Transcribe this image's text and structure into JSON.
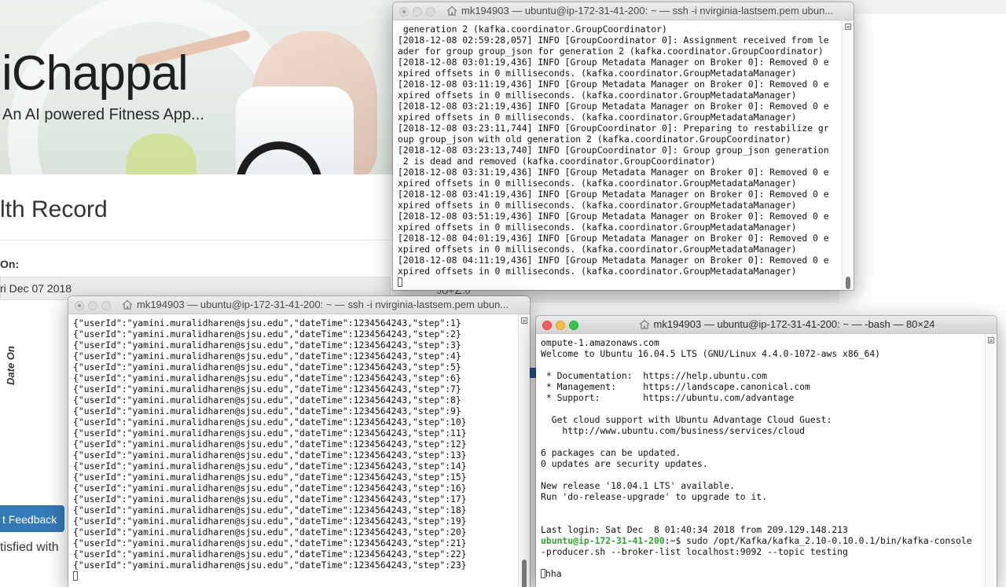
{
  "webpage": {
    "brand": "iChappal",
    "tagline": "An AI powered Fitness App...",
    "record_title": "lth Record",
    "on_label": "On:",
    "date_value": "ri Dec 07 2018",
    "date_on_label": "Date On",
    "feedback_button": "t Feedback",
    "satisfied_text": "tisfied with",
    "behind_text": "JU+∠.0"
  },
  "windows": {
    "kafka_server": {
      "title": "mk194903 — ubuntu@ip-172-31-41-200: ~ — ssh -i nvirginia-lastsem.pem ubun...",
      "lines": [
        " generation 2 (kafka.coordinator.GroupCoordinator)",
        "[2018-12-08 02:59:28,057] INFO [GroupCoordinator 0]: Assignment received from le",
        "ader for group group_json for generation 2 (kafka.coordinator.GroupCoordinator)",
        "[2018-12-08 03:01:19,436] INFO [Group Metadata Manager on Broker 0]: Removed 0 e",
        "xpired offsets in 0 milliseconds. (kafka.coordinator.GroupMetadataManager)",
        "[2018-12-08 03:11:19,436] INFO [Group Metadata Manager on Broker 0]: Removed 0 e",
        "xpired offsets in 0 milliseconds. (kafka.coordinator.GroupMetadataManager)",
        "[2018-12-08 03:21:19,436] INFO [Group Metadata Manager on Broker 0]: Removed 0 e",
        "xpired offsets in 0 milliseconds. (kafka.coordinator.GroupMetadataManager)",
        "[2018-12-08 03:23:11,744] INFO [GroupCoordinator 0]: Preparing to restabilize gr",
        "oup group_json with old generation 2 (kafka.coordinator.GroupCoordinator)",
        "[2018-12-08 03:23:13,740] INFO [GroupCoordinator 0]: Group group_json generation",
        " 2 is dead and removed (kafka.coordinator.GroupCoordinator)",
        "[2018-12-08 03:31:19,436] INFO [Group Metadata Manager on Broker 0]: Removed 0 e",
        "xpired offsets in 0 milliseconds. (kafka.coordinator.GroupMetadataManager)",
        "[2018-12-08 03:41:19,436] INFO [Group Metadata Manager on Broker 0]: Removed 0 e",
        "xpired offsets in 0 milliseconds. (kafka.coordinator.GroupMetadataManager)",
        "[2018-12-08 03:51:19,436] INFO [Group Metadata Manager on Broker 0]: Removed 0 e",
        "xpired offsets in 0 milliseconds. (kafka.coordinator.GroupMetadataManager)",
        "[2018-12-08 04:01:19,436] INFO [Group Metadata Manager on Broker 0]: Removed 0 e",
        "xpired offsets in 0 milliseconds. (kafka.coordinator.GroupMetadataManager)",
        "[2018-12-08 04:11:19,436] INFO [Group Metadata Manager on Broker 0]: Removed 0 e",
        "xpired offsets in 0 milliseconds. (kafka.coordinator.GroupMetadataManager)"
      ]
    },
    "consumer": {
      "title": "mk194903 — ubuntu@ip-172-31-41-200: ~ — ssh -i nvirginia-lastsem.pem ubun...",
      "lines": [
        "{\"userId\":\"yamini.muralidharen@sjsu.edu\",\"dateTime\":1234564243,\"step\":1}",
        "{\"userId\":\"yamini.muralidharen@sjsu.edu\",\"dateTime\":1234564243,\"step\":2}",
        "{\"userId\":\"yamini.muralidharen@sjsu.edu\",\"dateTime\":1234564243,\"step\":3}",
        "{\"userId\":\"yamini.muralidharen@sjsu.edu\",\"dateTime\":1234564243,\"step\":4}",
        "{\"userId\":\"yamini.muralidharen@sjsu.edu\",\"dateTime\":1234564243,\"step\":5}",
        "{\"userId\":\"yamini.muralidharen@sjsu.edu\",\"dateTime\":1234564243,\"step\":6}",
        "{\"userId\":\"yamini.muralidharen@sjsu.edu\",\"dateTime\":1234564243,\"step\":7}",
        "{\"userId\":\"yamini.muralidharen@sjsu.edu\",\"dateTime\":1234564243,\"step\":8}",
        "{\"userId\":\"yamini.muralidharen@sjsu.edu\",\"dateTime\":1234564243,\"step\":9}",
        "{\"userId\":\"yamini.muralidharen@sjsu.edu\",\"dateTime\":1234564243,\"step\":10}",
        "{\"userId\":\"yamini.muralidharen@sjsu.edu\",\"dateTime\":1234564243,\"step\":11}",
        "{\"userId\":\"yamini.muralidharen@sjsu.edu\",\"dateTime\":1234564243,\"step\":12}",
        "{\"userId\":\"yamini.muralidharen@sjsu.edu\",\"dateTime\":1234564243,\"step\":13}",
        "{\"userId\":\"yamini.muralidharen@sjsu.edu\",\"dateTime\":1234564243,\"step\":14}",
        "{\"userId\":\"yamini.muralidharen@sjsu.edu\",\"dateTime\":1234564243,\"step\":15}",
        "{\"userId\":\"yamini.muralidharen@sjsu.edu\",\"dateTime\":1234564243,\"step\":16}",
        "{\"userId\":\"yamini.muralidharen@sjsu.edu\",\"dateTime\":1234564243,\"step\":17}",
        "{\"userId\":\"yamini.muralidharen@sjsu.edu\",\"dateTime\":1234564243,\"step\":18}",
        "{\"userId\":\"yamini.muralidharen@sjsu.edu\",\"dateTime\":1234564243,\"step\":19}",
        "{\"userId\":\"yamini.muralidharen@sjsu.edu\",\"dateTime\":1234564243,\"step\":20}",
        "{\"userId\":\"yamini.muralidharen@sjsu.edu\",\"dateTime\":1234564243,\"step\":21}",
        "{\"userId\":\"yamini.muralidharen@sjsu.edu\",\"dateTime\":1234564243,\"step\":22}",
        "{\"userId\":\"yamini.muralidharen@sjsu.edu\",\"dateTime\":1234564243,\"step\":23}"
      ]
    },
    "producer": {
      "title": "mk194903 — ubuntu@ip-172-31-41-200: ~ — -bash — 80×24",
      "lines": [
        "ompute-1.amazonaws.com",
        "Welcome to Ubuntu 16.04.5 LTS (GNU/Linux 4.4.0-1072-aws x86_64)",
        "",
        " * Documentation:  https://help.ubuntu.com",
        " * Management:     https://landscape.canonical.com",
        " * Support:        https://ubuntu.com/advantage",
        "",
        "  Get cloud support with Ubuntu Advantage Cloud Guest:",
        "    http://www.ubuntu.com/business/services/cloud",
        "",
        "6 packages can be updated.",
        "0 updates are security updates.",
        "",
        "New release '18.04.1 LTS' available.",
        "Run 'do-release-upgrade' to upgrade to it.",
        "",
        "",
        "Last login: Sat Dec  8 01:40:34 2018 from 209.129.148.213"
      ],
      "prompt": "ubuntu@ip-172-31-41-200",
      "prompt_suffix": ":~$ ",
      "command": "sudo /opt/Kafka/kafka_2.10-0.10.0.1/bin/kafka-console",
      "command_cont": "-producer.sh --broker-list localhost:9092 --topic testing",
      "input_line": "hha"
    }
  },
  "icons": {
    "home": "home-folder-icon",
    "scroll": "scroll-menu-icon"
  },
  "colors": {
    "prompt_green": "#2ca42c",
    "button_blue": "#337ab7",
    "close_red": "#fc605c",
    "minimize_yellow": "#fdbc40",
    "maximize_green": "#34c84a"
  }
}
